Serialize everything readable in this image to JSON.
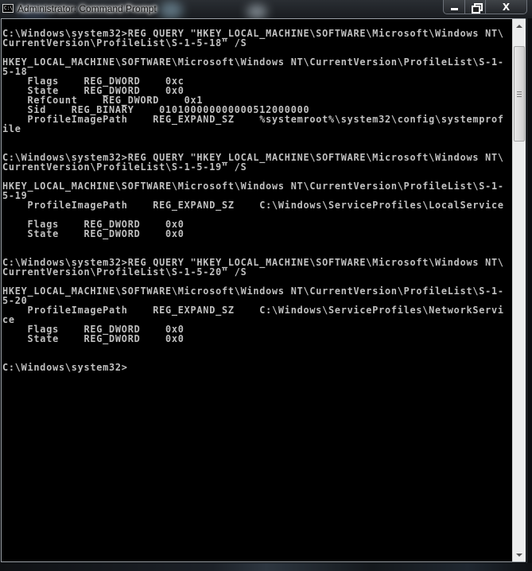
{
  "window": {
    "title": "Administrator: Command Prompt",
    "icon": "cmd-icon",
    "icon_text": "C:\\_",
    "buttons": {
      "minimize": "minimize",
      "restore": "restore",
      "close": "X"
    }
  },
  "console": {
    "lines": [
      "C:\\Windows\\system32>REG QUERY \"HKEY_LOCAL_MACHINE\\SOFTWARE\\Microsoft\\Windows NT\\",
      "CurrentVersion\\ProfileList\\S-1-5-18\" /S",
      "",
      "HKEY_LOCAL_MACHINE\\SOFTWARE\\Microsoft\\Windows NT\\CurrentVersion\\ProfileList\\S-1-",
      "5-18",
      "    Flags    REG_DWORD    0xc",
      "    State    REG_DWORD    0x0",
      "    RefCount    REG_DWORD    0x1",
      "    Sid    REG_BINARY    010100000000000512000000",
      "    ProfileImagePath    REG_EXPAND_SZ    %systemroot%\\system32\\config\\systemprof",
      "ile",
      "",
      "",
      "C:\\Windows\\system32>REG QUERY \"HKEY_LOCAL_MACHINE\\SOFTWARE\\Microsoft\\Windows NT\\",
      "CurrentVersion\\ProfileList\\S-1-5-19\" /S",
      "",
      "HKEY_LOCAL_MACHINE\\SOFTWARE\\Microsoft\\Windows NT\\CurrentVersion\\ProfileList\\S-1-",
      "5-19",
      "    ProfileImagePath    REG_EXPAND_SZ    C:\\Windows\\ServiceProfiles\\LocalService",
      "",
      "    Flags    REG_DWORD    0x0",
      "    State    REG_DWORD    0x0",
      "",
      "",
      "C:\\Windows\\system32>REG QUERY \"HKEY_LOCAL_MACHINE\\SOFTWARE\\Microsoft\\Windows NT\\",
      "CurrentVersion\\ProfileList\\S-1-5-20\" /S",
      "",
      "HKEY_LOCAL_MACHINE\\SOFTWARE\\Microsoft\\Windows NT\\CurrentVersion\\ProfileList\\S-1-",
      "5-20",
      "    ProfileImagePath    REG_EXPAND_SZ    C:\\Windows\\ServiceProfiles\\NetworkServi",
      "ce",
      "    Flags    REG_DWORD    0x0",
      "    State    REG_DWORD    0x0",
      "",
      "",
      "C:\\Windows\\system32>"
    ]
  },
  "colors": {
    "console_bg": "#000000",
    "console_fg": "#c0c0c0"
  }
}
